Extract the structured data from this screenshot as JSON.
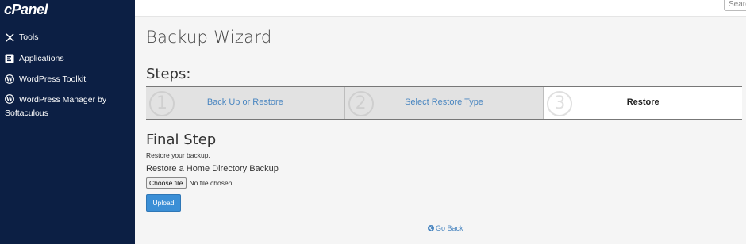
{
  "sidebar": {
    "logo": "cPanel",
    "items": [
      {
        "label": "Tools",
        "icon": "tools-icon"
      },
      {
        "label": "Applications",
        "icon": "applications-icon"
      },
      {
        "label": "WordPress Toolkit",
        "icon": "wordpress-icon"
      },
      {
        "label": "WordPress Manager by Softaculous",
        "icon": "wordpress-icon"
      }
    ]
  },
  "topbar": {
    "search_placeholder": "Search"
  },
  "main": {
    "title": "Backup Wizard",
    "steps_title": "Steps:",
    "steps": [
      {
        "number": "1",
        "label": "Back Up or Restore"
      },
      {
        "number": "2",
        "label": "Select Restore Type"
      },
      {
        "number": "3",
        "label": "Restore"
      }
    ],
    "final_step_title": "Final Step",
    "restore_desc": "Restore your backup.",
    "restore_heading": "Restore a Home Directory Backup",
    "choose_file_label": "Choose file",
    "no_file_text": "No file chosen",
    "upload_label": "Upload",
    "go_back_label": "Go Back"
  },
  "colors": {
    "sidebar_bg": "#0c1f44",
    "link": "#4a86c0",
    "primary_button": "#3b8fd6"
  }
}
